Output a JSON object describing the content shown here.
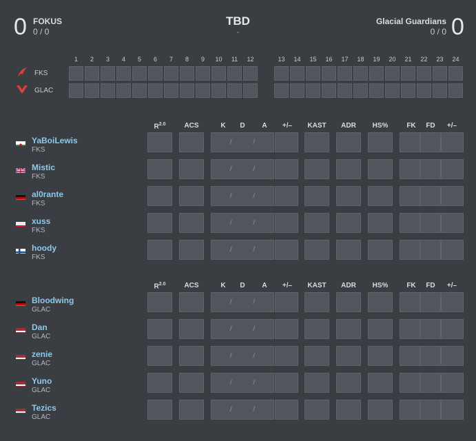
{
  "match": {
    "title": "TBD",
    "subtitle": "-",
    "team1": {
      "name": "FOKUS",
      "score": "0",
      "record": "0 / 0",
      "short": "FKS"
    },
    "team2": {
      "name": "Glacial Guardians",
      "score": "0",
      "record": "0 / 0",
      "short": "GLAC"
    }
  },
  "rounds": {
    "first_half": [
      "1",
      "2",
      "3",
      "4",
      "5",
      "6",
      "7",
      "8",
      "9",
      "10",
      "11",
      "12"
    ],
    "second_half": [
      "13",
      "14",
      "15",
      "16",
      "17",
      "18",
      "19",
      "20",
      "21",
      "22",
      "23",
      "24"
    ]
  },
  "stat_headers": {
    "rating_base": "R",
    "rating_sup": "2.0",
    "acs": "ACS",
    "k": "K",
    "d": "D",
    "a": "A",
    "pm": "+/–",
    "kast": "KAST",
    "adr": "ADR",
    "hs": "HS%",
    "fk": "FK",
    "fd": "FD",
    "pm2": "+/–"
  },
  "kda_separator": "/ /",
  "team1_players": [
    {
      "name": "YaBoiLewis",
      "team": "FKS",
      "flag": "wales-flag-icon"
    },
    {
      "name": "Mistic",
      "team": "FKS",
      "flag": "uk-flag-icon"
    },
    {
      "name": "al0rante",
      "team": "FKS",
      "flag": "germany-flag-icon"
    },
    {
      "name": "xuss",
      "team": "FKS",
      "flag": "poland-flag-icon"
    },
    {
      "name": "hoody",
      "team": "FKS",
      "flag": "finland-flag-icon"
    }
  ],
  "team2_players": [
    {
      "name": "Bloodwing",
      "team": "GLAC",
      "flag": "germany-flag-icon"
    },
    {
      "name": "Dan",
      "team": "GLAC",
      "flag": "latvia-flag-icon"
    },
    {
      "name": "zenie",
      "team": "GLAC",
      "flag": "latvia-flag-icon"
    },
    {
      "name": "Yuno",
      "team": "GLAC",
      "flag": "latvia-flag-icon"
    },
    {
      "name": "Tezics",
      "team": "GLAC",
      "flag": "latvia-flag-icon"
    }
  ],
  "colors": {
    "background": "#3a3d42",
    "cell": "#52565c",
    "player_name": "#8fc9ea",
    "accent_logo": "#e0403c"
  }
}
